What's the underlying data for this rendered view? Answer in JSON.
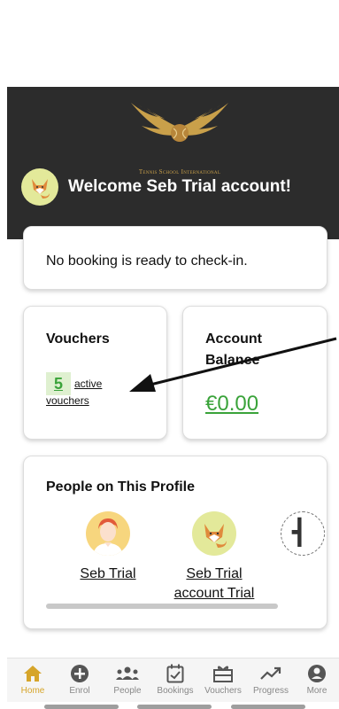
{
  "header": {
    "logo_text": "Tennis School International",
    "welcome": "Welcome Seb Trial account!"
  },
  "checkin": {
    "message": "No booking is ready to check-in."
  },
  "vouchers": {
    "title": "Vouchers",
    "count": "5",
    "suffix_line1": "active",
    "suffix_line2": "vouchers"
  },
  "balance": {
    "title": "Account Balance",
    "value": "€0.00"
  },
  "people": {
    "title": "People on This Profile",
    "items": [
      {
        "name": "Seb Trial",
        "icon": "person-avatar-icon"
      },
      {
        "name": "Seb Trial account Trial",
        "icon": "fox-avatar-icon"
      }
    ],
    "add_icon": "add-person-icon"
  },
  "nav": {
    "items": [
      {
        "label": "Home",
        "icon": "home-icon"
      },
      {
        "label": "Enrol",
        "icon": "plus-circle-icon"
      },
      {
        "label": "People",
        "icon": "people-icon"
      },
      {
        "label": "Bookings",
        "icon": "calendar-check-icon"
      },
      {
        "label": "Vouchers",
        "icon": "voucher-icon"
      },
      {
        "label": "Progress",
        "icon": "trending-up-icon"
      },
      {
        "label": "More",
        "icon": "user-circle-icon"
      }
    ]
  },
  "colors": {
    "header_bg": "#2c2c2c",
    "accent_gold": "#d6a52a",
    "green": "#3aa33a",
    "avatar_bg": "#e3e99a"
  }
}
